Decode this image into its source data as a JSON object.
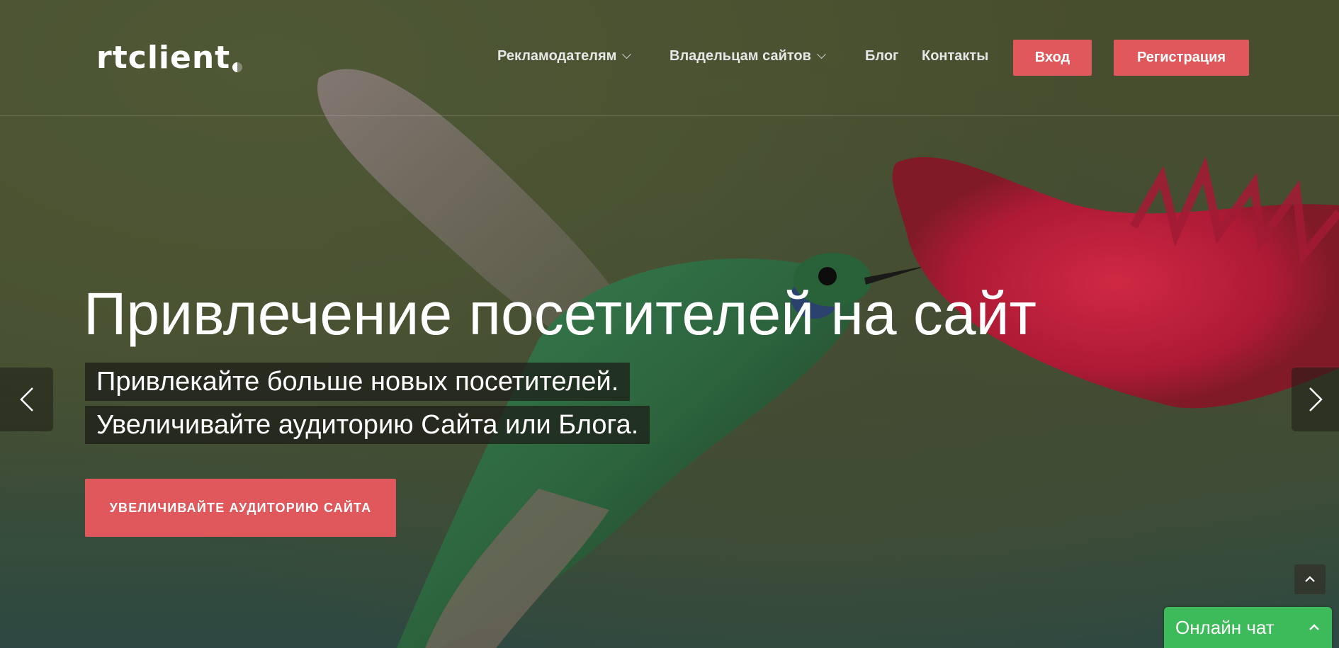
{
  "brand": {
    "logo_text": "rtclient"
  },
  "nav": {
    "advertisers": "Рекламодателям",
    "site_owners": "Владельцам сайтов",
    "blog": "Блог",
    "contacts": "Контакты",
    "login": "Вход",
    "register": "Регистрация"
  },
  "hero": {
    "title": "Привлечение посетителей на сайт",
    "line1": "Привлекайте больше новых посетителей.",
    "line2": "Увеличивайте аудиторию Сайта или Блога.",
    "cta": "УВЕЛИЧИВАЙТЕ АУДИТОРИЮ САЙТА"
  },
  "chat": {
    "label": "Онлайн чат"
  },
  "icons": {
    "prev": "chevron-left-icon",
    "next": "chevron-right-icon",
    "to_top": "chevron-up-icon",
    "chat_toggle": "chevron-up-icon",
    "dropdown": "chevron-down-icon"
  },
  "colors": {
    "accent": "#e0585b",
    "chat": "#3dba59"
  }
}
